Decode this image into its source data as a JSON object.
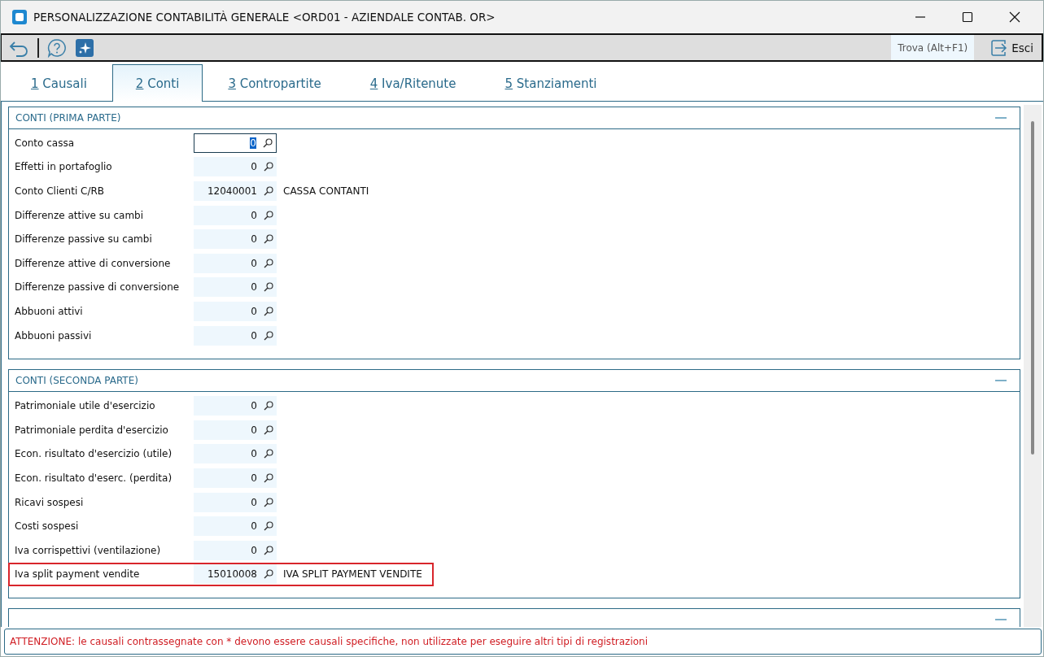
{
  "window": {
    "title": "PERSONALIZZAZIONE CONTABILITÀ GENERALE <ORD01 - AZIENDALE CONTAB. OR>"
  },
  "toolbar": {
    "find": "Trova (Alt+F1)",
    "exit": "Esci"
  },
  "tabs": [
    {
      "key": "1",
      "label": "Causali",
      "selected": false
    },
    {
      "key": "2",
      "label": "Conti",
      "selected": true
    },
    {
      "key": "3",
      "label": "Contropartite",
      "selected": false
    },
    {
      "key": "4",
      "label": "Iva/Ritenute",
      "selected": false
    },
    {
      "key": "5",
      "label": "Stanziamenti",
      "selected": false
    }
  ],
  "sections": [
    {
      "title": "CONTI (PRIMA PARTE)",
      "rows": [
        {
          "label": "Conto cassa",
          "value": "0",
          "focused": true,
          "highlighted": false
        },
        {
          "label": "Effetti in portafoglio",
          "value": "0",
          "focused": false,
          "highlighted": false
        },
        {
          "label": "Conto Clienti C/RB",
          "value": "12040001",
          "description": "CASSA CONTANTI",
          "focused": false,
          "highlighted": false
        },
        {
          "label": "Differenze attive su cambi",
          "value": "0",
          "focused": false,
          "highlighted": false
        },
        {
          "label": "Differenze passive su cambi",
          "value": "0",
          "focused": false,
          "highlighted": false
        },
        {
          "label": "Differenze attive di conversione",
          "value": "0",
          "focused": false,
          "highlighted": false
        },
        {
          "label": "Differenze passive di conversione",
          "value": "0",
          "focused": false,
          "highlighted": false
        },
        {
          "label": "Abbuoni attivi",
          "value": "0",
          "focused": false,
          "highlighted": false
        },
        {
          "label": "Abbuoni passivi",
          "value": "0",
          "focused": false,
          "highlighted": false
        }
      ]
    },
    {
      "title": "CONTI (SECONDA PARTE)",
      "rows": [
        {
          "label": "Patrimoniale utile d'esercizio",
          "value": "0",
          "focused": false,
          "highlighted": false
        },
        {
          "label": "Patrimoniale perdita d'esercizio",
          "value": "0",
          "focused": false,
          "highlighted": false
        },
        {
          "label": "Econ. risultato d'esercizio (utile)",
          "value": "0",
          "focused": false,
          "highlighted": false
        },
        {
          "label": "Econ. risultato d'eserc. (perdita)",
          "value": "0",
          "focused": false,
          "highlighted": false
        },
        {
          "label": "Ricavi sospesi",
          "value": "0",
          "focused": false,
          "highlighted": false
        },
        {
          "label": "Costi sospesi",
          "value": "0",
          "focused": false,
          "highlighted": false
        },
        {
          "label": "Iva corrispettivi (ventilazione)",
          "value": "0",
          "focused": false,
          "highlighted": false
        },
        {
          "label": "Iva split payment vendite",
          "value": "15010008",
          "description": "IVA SPLIT PAYMENT VENDITE",
          "focused": false,
          "highlighted": true
        }
      ]
    }
  ],
  "status_bar": "ATTENZIONE: le causali contrassegnate con * devono essere causali specifiche, non utilizzate per eseguire altri tipi di registrazioni"
}
